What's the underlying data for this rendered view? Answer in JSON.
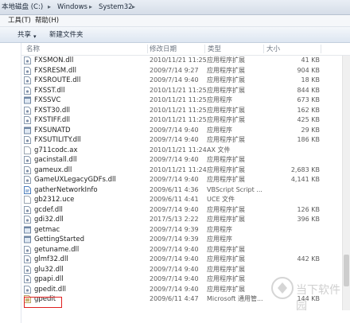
{
  "address": {
    "crumbs": [
      "本地磁盘 (C:)",
      "Windows",
      "System32"
    ]
  },
  "menu": {
    "tools": "工具(T)",
    "help": "帮助(H)"
  },
  "toolbar": {
    "share": "共享",
    "new_folder": "新建文件夹"
  },
  "columns": {
    "name": "名称",
    "date": "修改日期",
    "type": "类型",
    "size": "大小"
  },
  "files": [
    {
      "name": "FXSMON.dll",
      "date": "2010/11/21 11:25",
      "type": "应用程序扩展",
      "size": "41 KB",
      "icon": "dll-icon"
    },
    {
      "name": "FXSRESM.dll",
      "date": "2009/7/14 9:27",
      "type": "应用程序扩展",
      "size": "904 KB",
      "icon": "dll-icon"
    },
    {
      "name": "FXSROUTE.dll",
      "date": "2009/7/14 9:40",
      "type": "应用程序扩展",
      "size": "18 KB",
      "icon": "dll-icon"
    },
    {
      "name": "FXSST.dll",
      "date": "2010/11/21 11:25",
      "type": "应用程序扩展",
      "size": "844 KB",
      "icon": "dll-icon"
    },
    {
      "name": "FXSSVC",
      "date": "2010/11/21 11:25",
      "type": "应用程序",
      "size": "673 KB",
      "icon": "exe-icon"
    },
    {
      "name": "FXST30.dll",
      "date": "2010/11/21 11:25",
      "type": "应用程序扩展",
      "size": "162 KB",
      "icon": "dll-icon"
    },
    {
      "name": "FXSTIFF.dll",
      "date": "2010/11/21 11:25",
      "type": "应用程序扩展",
      "size": "425 KB",
      "icon": "dll-icon"
    },
    {
      "name": "FXSUNATD",
      "date": "2009/7/14 9:40",
      "type": "应用程序",
      "size": "29 KB",
      "icon": "exe-icon"
    },
    {
      "name": "FXSUTILITY.dll",
      "date": "2009/7/14 9:40",
      "type": "应用程序扩展",
      "size": "186 KB",
      "icon": "dll-icon"
    },
    {
      "name": "g711codc.ax",
      "date": "2010/11/21 11:24",
      "type": "AX 文件",
      "size": "",
      "icon": "file-icon"
    },
    {
      "name": "gacinstall.dll",
      "date": "2009/7/14 9:40",
      "type": "应用程序扩展",
      "size": "",
      "icon": "dll-icon"
    },
    {
      "name": "gameux.dll",
      "date": "2010/11/21 11:24",
      "type": "应用程序扩展",
      "size": "2,683 KB",
      "icon": "dll-icon"
    },
    {
      "name": "GameUXLegacyGDFs.dll",
      "date": "2009/7/14 9:40",
      "type": "应用程序扩展",
      "size": "4,141 KB",
      "icon": "dll-icon"
    },
    {
      "name": "gatherNetworkInfo",
      "date": "2009/6/11 4:36",
      "type": "VBScript Script ...",
      "size": "",
      "icon": "script-icon"
    },
    {
      "name": "gb2312.uce",
      "date": "2009/6/11 4:41",
      "type": "UCE 文件",
      "size": "",
      "icon": "file-icon"
    },
    {
      "name": "gcdef.dll",
      "date": "2009/7/14 9:40",
      "type": "应用程序扩展",
      "size": "126 KB",
      "icon": "dll-icon"
    },
    {
      "name": "gdi32.dll",
      "date": "2017/5/13 2:22",
      "type": "应用程序扩展",
      "size": "396 KB",
      "icon": "dll-icon"
    },
    {
      "name": "getmac",
      "date": "2009/7/14 9:39",
      "type": "应用程序",
      "size": "",
      "icon": "exe-icon"
    },
    {
      "name": "GettingStarted",
      "date": "2009/7/14 9:39",
      "type": "应用程序",
      "size": "",
      "icon": "exe-icon"
    },
    {
      "name": "getuname.dll",
      "date": "2009/7/14 9:40",
      "type": "应用程序扩展",
      "size": "",
      "icon": "dll-icon"
    },
    {
      "name": "glmf32.dll",
      "date": "2009/7/14 9:40",
      "type": "应用程序扩展",
      "size": "442 KB",
      "icon": "dll-icon"
    },
    {
      "name": "glu32.dll",
      "date": "2009/7/14 9:40",
      "type": "应用程序扩展",
      "size": "",
      "icon": "dll-icon"
    },
    {
      "name": "gpapi.dll",
      "date": "2009/7/14 9:40",
      "type": "应用程序扩展",
      "size": "",
      "icon": "dll-icon"
    },
    {
      "name": "gpedit.dll",
      "date": "2009/7/14 9:40",
      "type": "应用程序扩展",
      "size": "",
      "icon": "dll-icon"
    },
    {
      "name": "gpedit",
      "date": "2009/6/11 4:47",
      "type": "Microsoft 通用管...",
      "size": "144 KB",
      "icon": "msc-icon"
    }
  ],
  "watermark": {
    "text": "当下软件园"
  },
  "colors": {
    "highlight": "#e02020"
  }
}
